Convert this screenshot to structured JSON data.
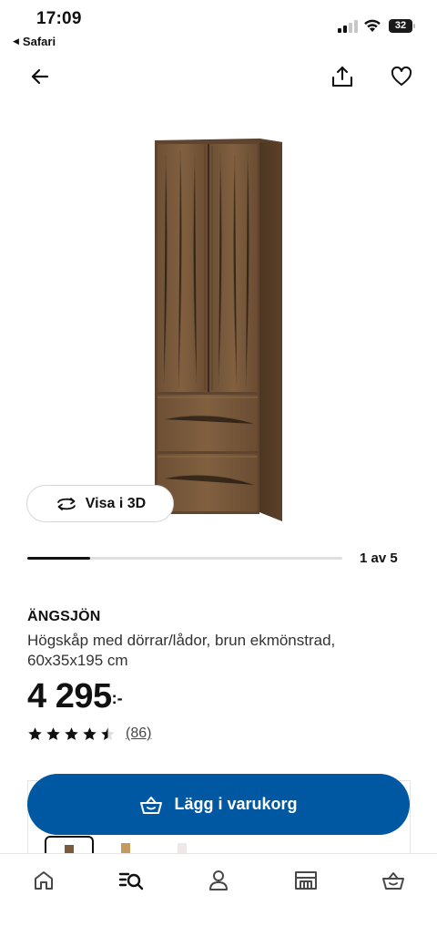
{
  "status_bar": {
    "time": "17:09",
    "back_app": "Safari",
    "battery_level": "32",
    "signal_bars_filled": 2,
    "signal_bars_total": 4
  },
  "nav": {
    "back_icon": "arrow-left-icon",
    "share_icon": "share-icon",
    "favorite_icon": "heart-icon"
  },
  "gallery": {
    "view_3d_label": "Visa i 3D",
    "view_3d_icon": "rotate-3d-icon",
    "counter": "1 av 5",
    "current_image": 1,
    "total_images": 5
  },
  "product": {
    "name": "ÄNGSJÖN",
    "description": "Högskåp med dörrar/lådor, brun ekmönstrad, 60x35x195 cm",
    "price_integer": "4 295",
    "price_suffix": ":-",
    "rating_value": 4.5,
    "rating_max": 5,
    "review_count": "(86)"
  },
  "cta": {
    "label": "Lägg i varukorg",
    "icon": "basket-icon"
  },
  "variants": [
    {
      "color": "#7a5a3c",
      "selected": true
    },
    {
      "color": "#c49a5e",
      "selected": false
    },
    {
      "color": "#f0e8e8",
      "selected": false
    }
  ],
  "tab_bar": {
    "items": [
      {
        "icon": "home-icon"
      },
      {
        "icon": "search-list-icon",
        "active": true
      },
      {
        "icon": "profile-icon"
      },
      {
        "icon": "store-icon"
      },
      {
        "icon": "basket-icon"
      }
    ]
  },
  "colors": {
    "brand_blue": "#0058a3",
    "wood_brown": "#6b4c33",
    "text_primary": "#111111"
  }
}
